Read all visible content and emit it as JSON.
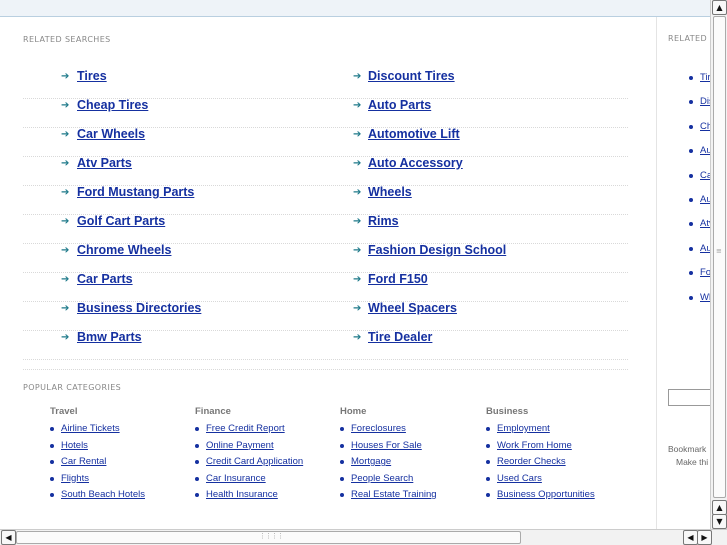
{
  "related": {
    "header": "RELATED SEARCHES",
    "left": [
      "Tires",
      "Cheap Tires",
      "Car Wheels",
      "Atv Parts",
      "Ford Mustang Parts",
      "Golf Cart Parts",
      "Chrome Wheels",
      "Car Parts",
      "Business Directories",
      "Bmw Parts"
    ],
    "right": [
      "Discount Tires",
      "Auto Parts",
      "Automotive Lift",
      "Auto Accessory",
      "Wheels",
      "Rims",
      "Fashion Design School",
      "Ford F150",
      "Wheel Spacers",
      "Tire Dealer"
    ],
    "arrow_glyph": "➔"
  },
  "popular": {
    "header": "POPULAR CATEGORIES",
    "columns": [
      {
        "title": "Travel",
        "items": [
          "Airline Tickets",
          "Hotels",
          "Car Rental",
          "Flights",
          "South Beach Hotels"
        ]
      },
      {
        "title": "Finance",
        "items": [
          "Free Credit Report",
          "Online Payment",
          "Credit Card Application",
          "Car Insurance",
          "Health Insurance"
        ]
      },
      {
        "title": "Home",
        "items": [
          "Foreclosures",
          "Houses For Sale",
          "Mortgage",
          "People Search",
          "Real Estate Training"
        ]
      },
      {
        "title": "Business",
        "items": [
          "Employment",
          "Work From Home",
          "Reorder Checks",
          "Used Cars",
          "Business Opportunities"
        ]
      }
    ]
  },
  "sidebar": {
    "header": "RELATED",
    "items": [
      "Tir",
      "Dis",
      "Ch",
      "Au",
      "Ca",
      "Au",
      "Atv",
      "Au",
      "Fo",
      "Wh"
    ],
    "bookmark_text": "Bookmark",
    "make_text": "Make thi"
  },
  "scrollbar": {
    "up": "▲",
    "down": "▼",
    "left": "◀",
    "right": "▶",
    "grip": "⋮⋮⋮⋮"
  },
  "colors": {
    "link": "#1530a0",
    "arrow": "#1f7a8a",
    "header": "#888888"
  }
}
